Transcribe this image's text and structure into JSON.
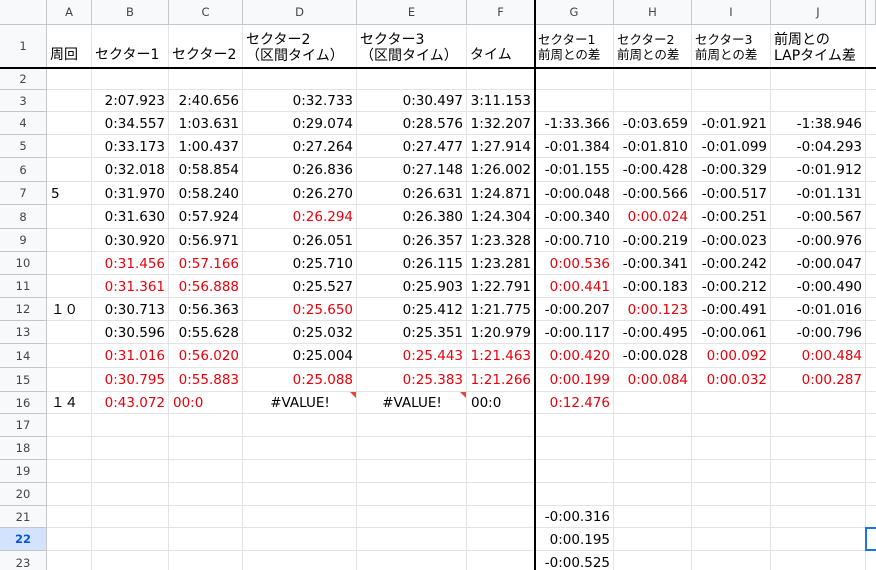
{
  "columns": [
    "A",
    "B",
    "C",
    "D",
    "E",
    "F",
    "G",
    "H",
    "I",
    "J"
  ],
  "rows": [
    "1",
    "2",
    "3",
    "4",
    "5",
    "6",
    "7",
    "8",
    "9",
    "10",
    "11",
    "12",
    "13",
    "14",
    "15",
    "16",
    "17",
    "18",
    "19",
    "20",
    "21",
    "22",
    "23"
  ],
  "selected_row": "22",
  "header": {
    "A": "周回",
    "B": "セクター1",
    "C": "セクター2",
    "D": "セクター2\n（区間タイム）",
    "E": "セクター3\n（区間タイム）",
    "F": "タイム",
    "G": "セクター1\n前周との差",
    "H": "セクター2\n前周との差",
    "I": "セクター3\n前周との差",
    "J": "前周との\nLAPタイム差"
  },
  "data": {
    "3": {
      "A": "",
      "B": "2:07.923",
      "C": "2:40.656",
      "D": "0:32.733",
      "E": "0:30.497",
      "F": "3:11.153",
      "G": "",
      "H": "",
      "I": "",
      "J": ""
    },
    "4": {
      "A": "",
      "B": "0:34.557",
      "C": "1:03.631",
      "D": "0:29.074",
      "E": "0:28.576",
      "F": "1:32.207",
      "G": "-1:33.366",
      "H": "-0:03.659",
      "I": "-0:01.921",
      "J": "-1:38.946"
    },
    "5": {
      "A": "",
      "B": "0:33.173",
      "C": "1:00.437",
      "D": "0:27.264",
      "E": "0:27.477",
      "F": "1:27.914",
      "G": "-0:01.384",
      "H": "-0:01.810",
      "I": "-0:01.099",
      "J": "-0:04.293"
    },
    "6": {
      "A": "",
      "B": "0:32.018",
      "C": "0:58.854",
      "D": "0:26.836",
      "E": "0:27.148",
      "F": "1:26.002",
      "G": "-0:01.155",
      "H": "-0:00.428",
      "I": "-0:00.329",
      "J": "-0:01.912"
    },
    "7": {
      "A": "5",
      "B": "0:31.970",
      "C": "0:58.240",
      "D": "0:26.270",
      "E": "0:26.631",
      "F": "1:24.871",
      "G": "-0:00.048",
      "H": "-0:00.566",
      "I": "-0:00.517",
      "J": "-0:01.131"
    },
    "8": {
      "A": "",
      "B": "0:31.630",
      "C": "0:57.924",
      "D": "0:26.294",
      "E": "0:26.380",
      "F": "1:24.304",
      "G": "-0:00.340",
      "H": "0:00.024",
      "I": "-0:00.251",
      "J": "-0:00.567"
    },
    "9": {
      "A": "",
      "B": "0:30.920",
      "C": "0:56.971",
      "D": "0:26.051",
      "E": "0:26.357",
      "F": "1:23.328",
      "G": "-0:00.710",
      "H": "-0:00.219",
      "I": "-0:00.023",
      "J": "-0:00.976"
    },
    "10": {
      "A": "",
      "B": "0:31.456",
      "C": "0:57.166",
      "D": "0:25.710",
      "E": "0:26.115",
      "F": "1:23.281",
      "G": "0:00.536",
      "H": "-0:00.341",
      "I": "-0:00.242",
      "J": "-0:00.047"
    },
    "11": {
      "A": "",
      "B": "0:31.361",
      "C": "0:56.888",
      "D": "0:25.527",
      "E": "0:25.903",
      "F": "1:22.791",
      "G": "0:00.441",
      "H": "-0:00.183",
      "I": "-0:00.212",
      "J": "-0:00.490"
    },
    "12": {
      "A": "１０",
      "B": "0:30.713",
      "C": "0:56.363",
      "D": "0:25.650",
      "E": "0:25.412",
      "F": "1:21.775",
      "G": "-0:00.207",
      "H": "0:00.123",
      "I": "-0:00.491",
      "J": "-0:01.016"
    },
    "13": {
      "A": "",
      "B": "0:30.596",
      "C": "0:55.628",
      "D": "0:25.032",
      "E": "0:25.351",
      "F": "1:20.979",
      "G": "-0:00.117",
      "H": "-0:00.495",
      "I": "-0:00.061",
      "J": "-0:00.796"
    },
    "14": {
      "A": "",
      "B": "0:31.016",
      "C": "0:56.020",
      "D": "0:25.004",
      "E": "0:25.443",
      "F": "1:21.463",
      "G": "0:00.420",
      "H": "-0:00.028",
      "I": "0:00.092",
      "J": "0:00.484"
    },
    "15": {
      "A": "",
      "B": "0:30.795",
      "C": "0:55.883",
      "D": "0:25.088",
      "E": "0:25.383",
      "F": "1:21.266",
      "G": "0:00.199",
      "H": "0:00.084",
      "I": "0:00.032",
      "J": "0:00.287"
    },
    "16": {
      "A": "１４",
      "B": "0:43.072",
      "C": "00:0",
      "D": "#VALUE!",
      "E": "#VALUE!",
      "F": "00:0",
      "G": "0:12.476",
      "H": "",
      "I": "",
      "J": ""
    },
    "21": {
      "G": "-0:00.316"
    },
    "22": {
      "G": "0:00.195"
    },
    "23": {
      "G": "-0:00.525"
    }
  },
  "red_cells": [
    "D8",
    "H8",
    "B10",
    "C10",
    "G10",
    "B11",
    "C11",
    "G11",
    "D12",
    "H12",
    "B14",
    "C14",
    "E14",
    "F14",
    "G14",
    "I14",
    "J14",
    "B15",
    "C15",
    "D15",
    "E15",
    "F15",
    "G15",
    "H15",
    "I15",
    "J15",
    "B16",
    "C16",
    "G16"
  ],
  "error_cells": [
    "D16",
    "E16"
  ],
  "accent_colors": {
    "red": "#e8000b",
    "selection": "#1a73e8",
    "error_flag": "#ea4335"
  }
}
